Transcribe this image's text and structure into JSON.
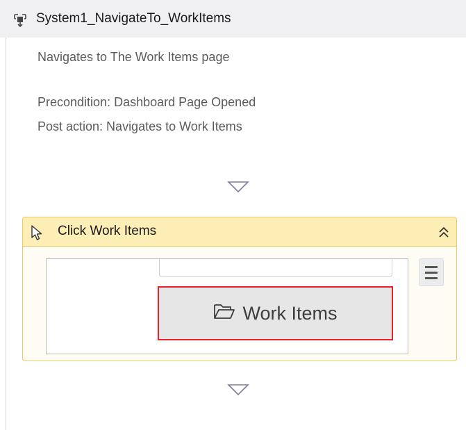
{
  "sequence": {
    "title": "System1_NavigateTo_WorkItems",
    "description": "Navigates to The Work Items page",
    "precondition": "Precondition: Dashboard Page Opened",
    "post_action": "Post action: Navigates to Work Items",
    "icon": "sequence-icon"
  },
  "activity": {
    "title": "Click Work Items",
    "icon": "pointer-icon",
    "collapse_icon": "double-chevron-up-icon",
    "menu_icon": "hamburger-menu-icon",
    "target_button_label": "Work Items",
    "target_button_icon": "folder-open-icon",
    "highlight_color": "#e8202a"
  },
  "colors": {
    "header_bg": "#f0f0f2",
    "activity_header_bg": "#fdeeb5",
    "activity_border": "#f0c860"
  }
}
